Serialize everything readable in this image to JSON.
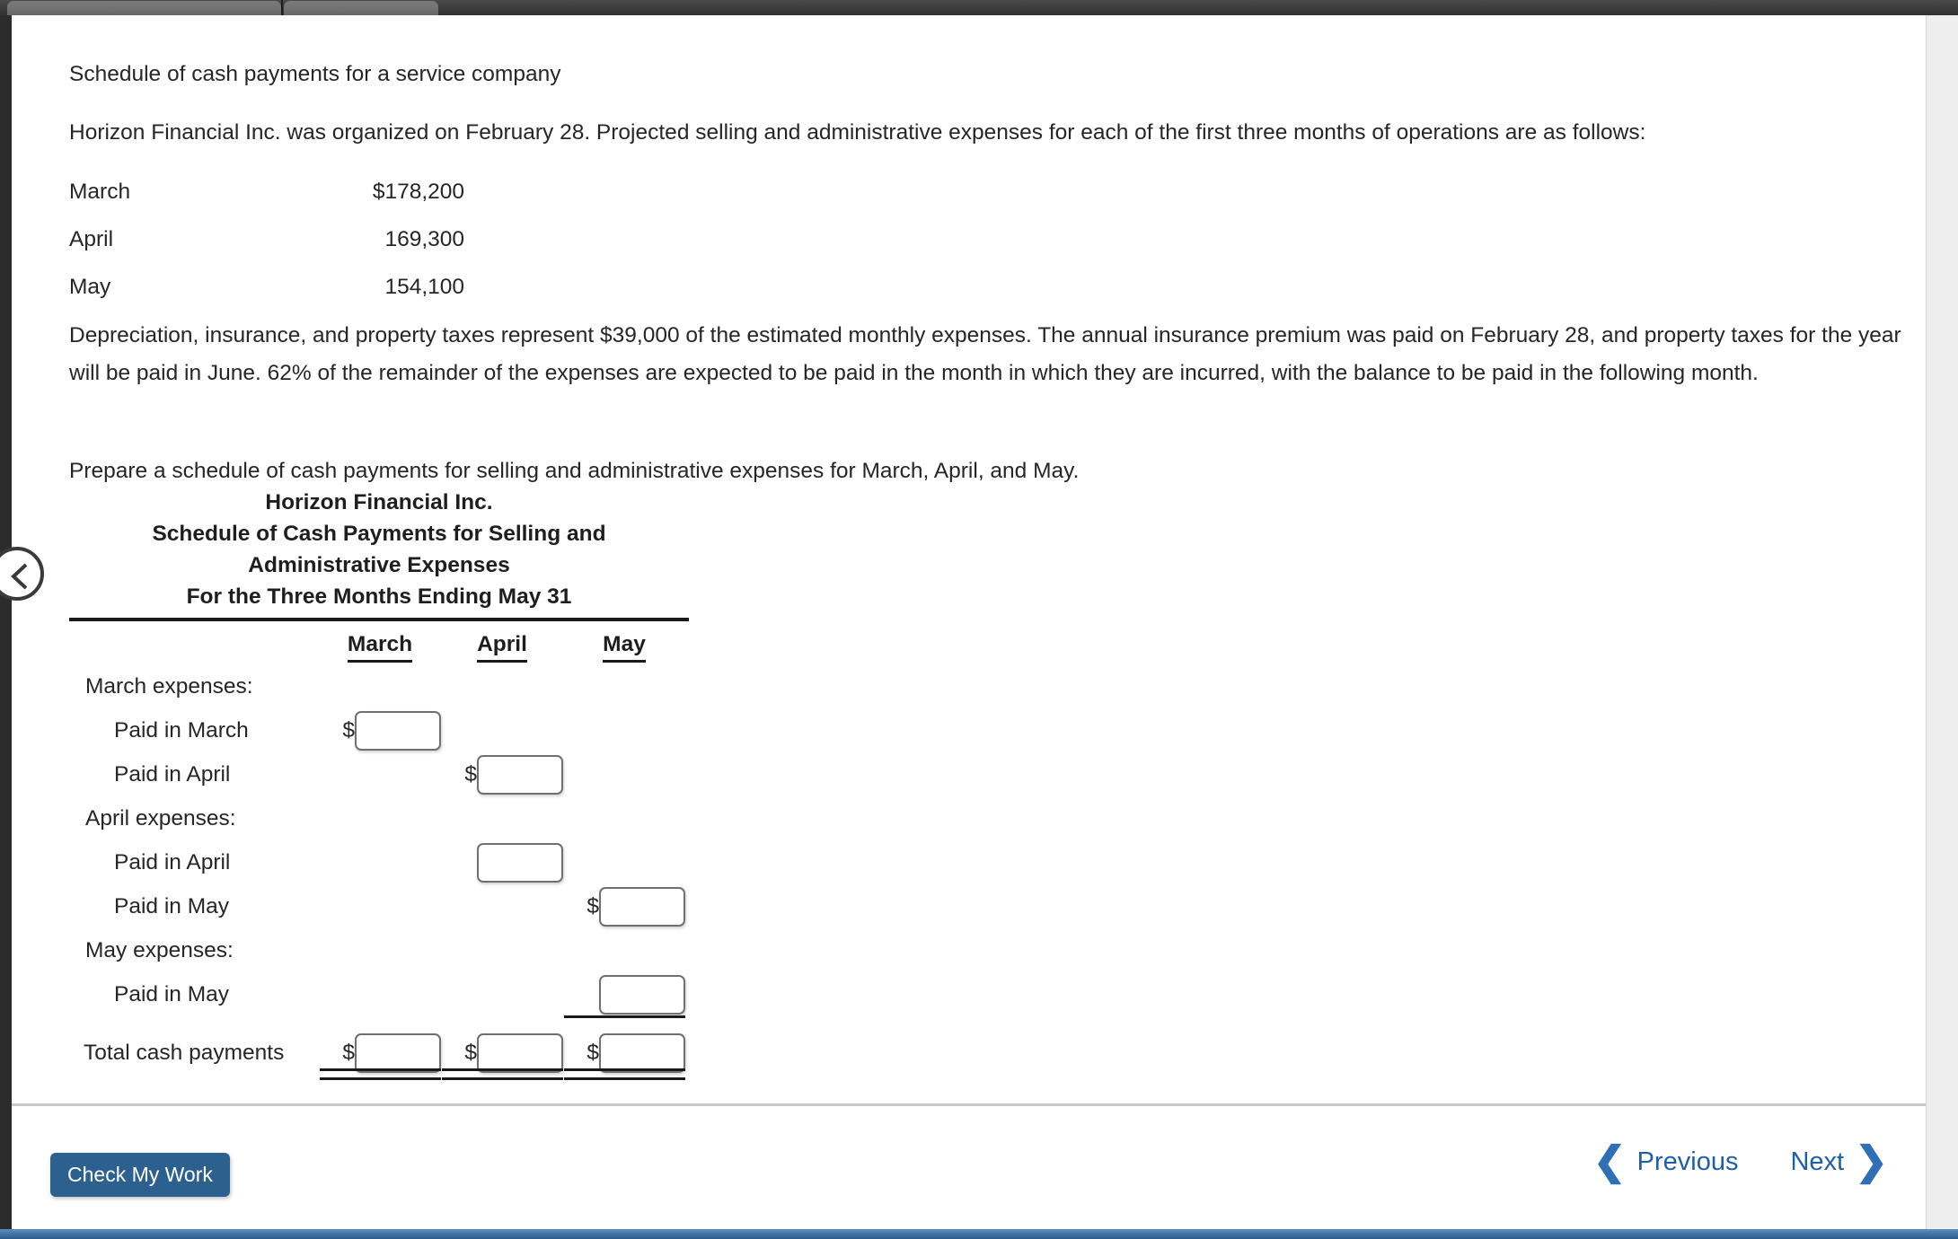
{
  "browser": {
    "tabs": [
      {
        "title": ""
      },
      {
        "title": ""
      }
    ]
  },
  "question": {
    "prompt_heading": "Schedule of cash payments for a service company",
    "intro_paragraph": "Horizon Financial Inc. was organized on February 28. Projected selling and administrative expenses for each of the first three months of operations are as follows:",
    "expenses": [
      {
        "month": "March",
        "amount": "$178,200"
      },
      {
        "month": "April",
        "amount": "169,300"
      },
      {
        "month": "May",
        "amount": "154,100"
      }
    ],
    "details_paragraph": "Depreciation, insurance, and property taxes represent $39,000 of the estimated monthly expenses. The annual insurance premium was paid on February 28, and property taxes for the year will be paid in June. 62% of the remainder of the expenses are expected to be paid in the month in which they are incurred, with the balance to be paid in the following month.",
    "instruction_paragraph": "Prepare a schedule of cash payments for selling and administrative expenses for March, April, and May."
  },
  "schedule": {
    "title_lines": [
      "Horizon Financial Inc.",
      "Schedule of Cash Payments for Selling and",
      "Administrative Expenses",
      "For the Three Months Ending May 31"
    ],
    "columns": [
      "March",
      "April",
      "May"
    ],
    "rows": [
      {
        "label": "March expenses:",
        "indent": "section",
        "cells": [
          null,
          null,
          null
        ]
      },
      {
        "label": "Paid in March",
        "indent": "indent",
        "cells": [
          {
            "dollar": "$",
            "value": ""
          },
          null,
          null
        ]
      },
      {
        "label": "Paid in April",
        "indent": "indent",
        "cells": [
          null,
          {
            "dollar": "$",
            "value": ""
          },
          null
        ]
      },
      {
        "label": "April expenses:",
        "indent": "section",
        "cells": [
          null,
          null,
          null
        ]
      },
      {
        "label": "Paid in April",
        "indent": "indent",
        "cells": [
          null,
          {
            "dollar": "",
            "value": ""
          },
          null
        ]
      },
      {
        "label": "Paid in May",
        "indent": "indent",
        "cells": [
          null,
          null,
          {
            "dollar": "$",
            "value": ""
          }
        ]
      },
      {
        "label": "May expenses:",
        "indent": "section",
        "cells": [
          null,
          null,
          null
        ]
      },
      {
        "label": "Paid in May",
        "indent": "indent",
        "cells": [
          null,
          null,
          {
            "dollar": "",
            "value": "",
            "rule": "single"
          }
        ]
      },
      {
        "label": "Total cash payments",
        "indent": "total",
        "cells": [
          {
            "dollar": "$",
            "value": "",
            "rule": "double"
          },
          {
            "dollar": "$",
            "value": "",
            "rule": "double"
          },
          {
            "dollar": "$",
            "value": "",
            "rule": "double"
          }
        ]
      }
    ]
  },
  "footer": {
    "check_my_work_label": "Check My Work",
    "previous_label": "Previous",
    "next_label": "Next",
    "previous_chevron": "❮",
    "next_chevron": "❯"
  },
  "colors": {
    "brand_blue": "#2c608f",
    "link_blue": "#1f5fa8",
    "bottom_bar": "#3d6e9f",
    "text": "#262626",
    "rule": "#1a1a1a",
    "input_border": "#707070"
  }
}
